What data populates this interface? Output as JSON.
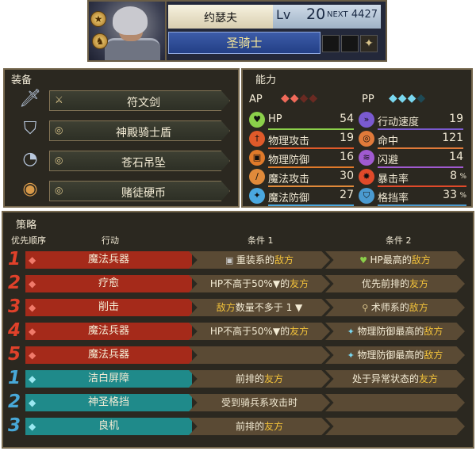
{
  "unit": {
    "name": "约瑟夫",
    "level_label": "Lv",
    "level": "20",
    "next_label": "NEXT",
    "next_value": "4427",
    "class": "圣骑士"
  },
  "equipment": {
    "title": "装备",
    "items": [
      {
        "name": "符文剑",
        "icon": "sword-icon",
        "slot_icon": "sword-slot-icon"
      },
      {
        "name": "神殿骑士盾",
        "icon": "shield-icon",
        "slot_icon": "ring-slot-icon"
      },
      {
        "name": "苍石吊坠",
        "icon": "pendant-icon",
        "slot_icon": "ring-slot-icon"
      },
      {
        "name": "赌徒硬币",
        "icon": "coin-icon",
        "slot_icon": "ring-slot-icon"
      }
    ]
  },
  "abilities": {
    "title": "能力",
    "ap_label": "AP",
    "pp_label": "PP",
    "ap_filled": 2,
    "ap_total": 4,
    "pp_filled": 3,
    "pp_total": 4,
    "stats_left": [
      {
        "label": "HP",
        "value": "54",
        "icon": "heart-icon",
        "color": "#8bd04a"
      },
      {
        "label": "物理攻击",
        "value": "19",
        "icon": "sword-stat-icon",
        "color": "#e05a2a"
      },
      {
        "label": "物理防御",
        "value": "16",
        "icon": "armor-stat-icon",
        "color": "#e07a2a"
      },
      {
        "label": "魔法攻击",
        "value": "30",
        "icon": "staff-stat-icon",
        "color": "#e08a3a"
      },
      {
        "label": "魔法防御",
        "value": "27",
        "icon": "magic-def-icon",
        "color": "#4aa8e0"
      }
    ],
    "stats_right": [
      {
        "label": "行动速度",
        "value": "19",
        "icon": "speed-icon",
        "color": "#7a5ad0"
      },
      {
        "label": "命中",
        "value": "121",
        "icon": "target-icon",
        "color": "#e07a3a"
      },
      {
        "label": "闪避",
        "value": "14",
        "icon": "evade-icon",
        "color": "#a05ad0"
      },
      {
        "label": "暴击率",
        "value": "8",
        "unit": "%",
        "icon": "crit-icon",
        "color": "#e04a2a"
      },
      {
        "label": "格挡率",
        "value": "33",
        "unit": "%",
        "icon": "block-icon",
        "color": "#4a9ad0"
      }
    ]
  },
  "strategy": {
    "title": "策略",
    "headers": {
      "priority": "优先顺序",
      "action": "行动",
      "cond1": "条件 1",
      "cond2": "条件 2"
    },
    "rows": [
      {
        "num": "1",
        "type": "red",
        "action": "魔法兵器",
        "cond1_icon": "armor-icon",
        "cond1_pre": "重装系的",
        "cond1_hl": "敌方",
        "cond1_post": "",
        "cond2_icon": "heart-icon",
        "cond2_pre": "HP最高的",
        "cond2_hl": "敌方",
        "cond2_post": ""
      },
      {
        "num": "2",
        "type": "red",
        "action": "疗愈",
        "cond1_icon": "",
        "cond1_pre": "HP不高于50%▼的",
        "cond1_hl": "友方",
        "cond1_post": "",
        "cond2_icon": "",
        "cond2_pre": "优先前排的",
        "cond2_hl": "友方",
        "cond2_post": ""
      },
      {
        "num": "3",
        "type": "red",
        "action": "削击",
        "cond1_icon": "",
        "cond1_pre": "",
        "cond1_hl": "敌方",
        "cond1_post": "数量不多于 1 ▼",
        "cond2_icon": "staff-icon",
        "cond2_pre": "术师系的",
        "cond2_hl": "敌方",
        "cond2_post": ""
      },
      {
        "num": "4",
        "type": "red",
        "action": "魔法兵器",
        "cond1_icon": "",
        "cond1_pre": "HP不高于50%▼的",
        "cond1_hl": "友方",
        "cond1_post": "",
        "cond2_icon": "defense-icon",
        "cond2_pre": "物理防御最高的",
        "cond2_hl": "敌方",
        "cond2_post": ""
      },
      {
        "num": "5",
        "type": "red",
        "action": "魔法兵器",
        "cond1_icon": "",
        "cond1_pre": "",
        "cond1_hl": "",
        "cond1_post": "",
        "cond2_icon": "defense-icon",
        "cond2_pre": "物理防御最高的",
        "cond2_hl": "敌方",
        "cond2_post": ""
      },
      {
        "num": "1",
        "type": "teal",
        "action": "洁白屏障",
        "cond1_icon": "",
        "cond1_pre": "前排的",
        "cond1_hl": "友方",
        "cond1_post": "",
        "cond2_icon": "",
        "cond2_pre": "处于异常状态的",
        "cond2_hl": "友方",
        "cond2_post": ""
      },
      {
        "num": "2",
        "type": "teal",
        "action": "神圣格挡",
        "cond1_icon": "",
        "cond1_pre": "受到骑兵系攻击时",
        "cond1_hl": "",
        "cond1_post": "",
        "cond2_icon": "",
        "cond2_pre": "",
        "cond2_hl": "",
        "cond2_post": ""
      },
      {
        "num": "3",
        "type": "teal",
        "action": "良机",
        "cond1_icon": "",
        "cond1_pre": "前排的",
        "cond1_hl": "友方",
        "cond1_post": "",
        "cond2_icon": "",
        "cond2_pre": "",
        "cond2_hl": "",
        "cond2_post": ""
      }
    ]
  },
  "colors": {
    "red_action": "#a52a1a",
    "teal_action": "#1f8a8a",
    "highlight": "#f2c23a",
    "red_num": "#e0412a",
    "teal_num": "#48a8d8"
  }
}
